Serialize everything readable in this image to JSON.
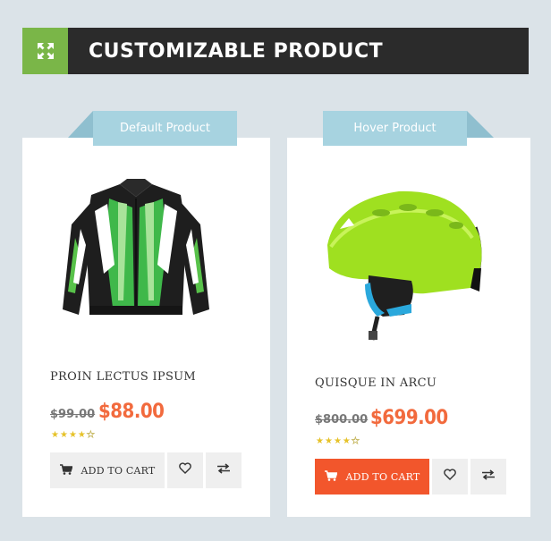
{
  "header": {
    "title": "CUSTOMIZABLE PRODUCT",
    "icon": "expand-arrows-icon",
    "accent_color": "#7ab648"
  },
  "products": [
    {
      "ribbon": "Default Product",
      "name": "PROIN LECTUS IPSUM",
      "old_price": "$99.00",
      "new_price": "$88.00",
      "rating": 4,
      "rating_max": 5,
      "cart_label": "ADD TO CART",
      "image": "green-black-motorcycle-jacket"
    },
    {
      "ribbon": "Hover Product",
      "name": "QUISQUE IN ARCU",
      "old_price": "$800.00",
      "new_price": "$699.00",
      "rating": 4,
      "rating_max": 5,
      "cart_label": "ADD TO CART",
      "image": "lime-green-ski-helmet"
    }
  ],
  "colors": {
    "price": "#f26a3d",
    "cart_active": "#f2562c",
    "ribbon": "#a7d3e0",
    "star": "#e6c229"
  }
}
